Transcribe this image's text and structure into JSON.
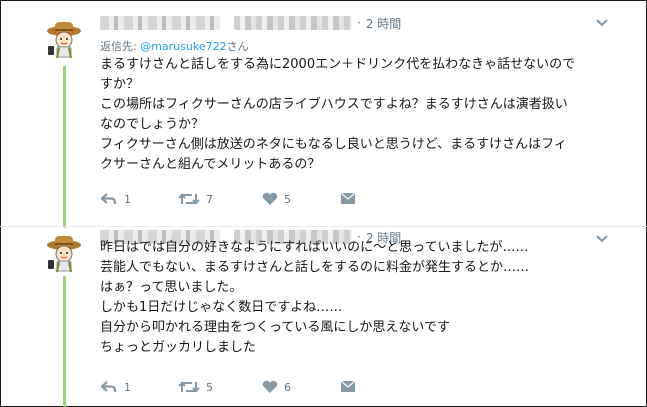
{
  "tweets": [
    {
      "time": "2 時間",
      "reply_label": "返信先: ",
      "reply_handle": "@marusuke722",
      "reply_suffix": "さん",
      "lines": [
        "まるすけさんと話しをする為に2000エン＋ドリンク代を払わなきゃ話せないので",
        "すか？",
        "この場所はフィクサーさんの店ライブハウスですよね？まるすけさんは演者扱い",
        "なのでしょうか？",
        "フィクサーさん側は放送のネタにもなるし良いと思うけど、まるすけさんはフィ",
        "クサーさんと組んでメリットあるの？"
      ],
      "actions": {
        "reply": "1",
        "retweet": "7",
        "like": "5"
      }
    },
    {
      "time": "2 時間",
      "lines": [
        "昨日はでは自分の好きなようにすればいいのに〜と思っていましたが……",
        "芸能人でもない、まるすけさんと話しをするのに料金が発生するとか……",
        "はぁ？って思いました。",
        "しかも1日だけじゃなく数日ですよね……",
        "自分から叩かれる理由をつくっている風にしか思えないです",
        "ちょっとガッカリしました"
      ],
      "actions": {
        "reply": "1",
        "retweet": "5",
        "like": "6"
      }
    }
  ],
  "icons": [
    "reply-icon",
    "retweet-icon",
    "heart-icon",
    "dm-icon",
    "chevron-down-icon",
    "avatar"
  ],
  "colors": {
    "accent": "#1da1f2",
    "thread": "#9bd07d",
    "muted": "#657786"
  }
}
